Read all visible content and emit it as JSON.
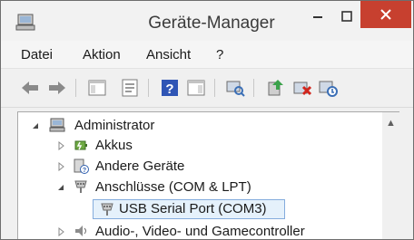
{
  "window": {
    "title": "Geräte-Manager",
    "controls": {
      "minimize": "–",
      "maximize": "□",
      "close": "×"
    }
  },
  "menu": [
    "Datei",
    "Aktion",
    "Ansicht",
    "?"
  ],
  "toolbar": {
    "icons": [
      "back-arrow-icon",
      "forward-arrow-icon",
      "console-tree-icon",
      "properties-icon",
      "help-icon",
      "action-pane-icon",
      "scan-hardware-icon",
      "update-driver-icon",
      "uninstall-device-icon",
      "disable-device-icon"
    ]
  },
  "tree": {
    "root": "Administrator",
    "items": [
      {
        "label": "Akkus",
        "state": "collapsed"
      },
      {
        "label": "Andere Geräte",
        "state": "collapsed"
      },
      {
        "label": "Anschlüsse (COM & LPT)",
        "state": "expanded"
      },
      {
        "label": "USB Serial Port (COM3)",
        "state": "selected"
      },
      {
        "label": "Audio-, Video- und Gamecontroller",
        "state": "collapsed"
      }
    ]
  },
  "colors": {
    "close_button": "#c7402f",
    "selection_fill": "#e5f1fb",
    "selection_border": "#84acdd"
  }
}
